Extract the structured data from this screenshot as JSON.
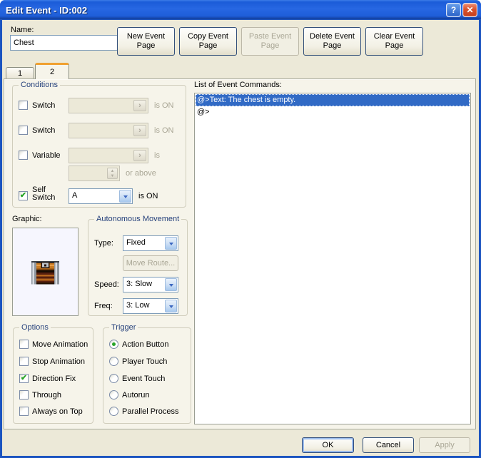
{
  "window": {
    "title": "Edit Event - ID:002",
    "help_glyph": "?",
    "close_glyph": "✕"
  },
  "header": {
    "name_label": "Name:",
    "name_value": "Chest"
  },
  "page_buttons": [
    {
      "label": "New Event Page",
      "enabled": true
    },
    {
      "label": "Copy Event Page",
      "enabled": true
    },
    {
      "label": "Paste Event Page",
      "enabled": false
    },
    {
      "label": "Delete Event Page",
      "enabled": true
    },
    {
      "label": "Clear Event Page",
      "enabled": true
    }
  ],
  "tabs": [
    {
      "label": "1",
      "active": false
    },
    {
      "label": "2",
      "active": true
    }
  ],
  "conditions": {
    "title": "Conditions",
    "switch1": {
      "label": "Switch",
      "checked": false,
      "value": "",
      "suffix": "is ON",
      "enabled": false
    },
    "switch2": {
      "label": "Switch",
      "checked": false,
      "value": "",
      "suffix": "is ON",
      "enabled": false
    },
    "variable": {
      "label": "Variable",
      "checked": false,
      "value": "",
      "suffix": "is",
      "enabled": false
    },
    "variable_amount": {
      "value": "",
      "suffix": "or above",
      "enabled": false
    },
    "self_switch": {
      "label_line1": "Self",
      "label_line2": "Switch",
      "checked": true,
      "value": "A",
      "suffix": "is ON",
      "enabled": true
    }
  },
  "graphic": {
    "label": "Graphic:",
    "sprite": "treasure-chest"
  },
  "movement": {
    "title": "Autonomous Movement",
    "type_label": "Type:",
    "type_value": "Fixed",
    "move_route_label": "Move Route...",
    "move_route_enabled": false,
    "speed_label": "Speed:",
    "speed_value": "3: Slow",
    "freq_label": "Freq:",
    "freq_value": "3: Low"
  },
  "options": {
    "title": "Options",
    "items": [
      {
        "label": "Move Animation",
        "checked": false
      },
      {
        "label": "Stop Animation",
        "checked": false
      },
      {
        "label": "Direction Fix",
        "checked": true
      },
      {
        "label": "Through",
        "checked": false
      },
      {
        "label": "Always on Top",
        "checked": false
      }
    ]
  },
  "trigger": {
    "title": "Trigger",
    "items": [
      {
        "label": "Action Button",
        "selected": true
      },
      {
        "label": "Player Touch",
        "selected": false
      },
      {
        "label": "Event Touch",
        "selected": false
      },
      {
        "label": "Autorun",
        "selected": false
      },
      {
        "label": "Parallel Process",
        "selected": false
      }
    ]
  },
  "commands": {
    "label": "List of Event Commands:",
    "items": [
      {
        "text": "@>Text: The chest is empty.",
        "selected": true
      },
      {
        "text": "@>",
        "selected": false
      }
    ]
  },
  "footer": {
    "ok": "OK",
    "cancel": "Cancel",
    "apply": "Apply",
    "ok_default": true,
    "apply_enabled": false
  },
  "colors": {
    "titlebar_blue": "#2767e2",
    "selection_blue": "#316ac5",
    "group_label_blue": "#27427c",
    "tab_accent_orange": "#f0a030",
    "check_green": "#26a426",
    "window_frame_blue": "#1b54c0",
    "dialog_beige": "#ece9d8",
    "tab_panel_cream": "#f6f4ea"
  }
}
